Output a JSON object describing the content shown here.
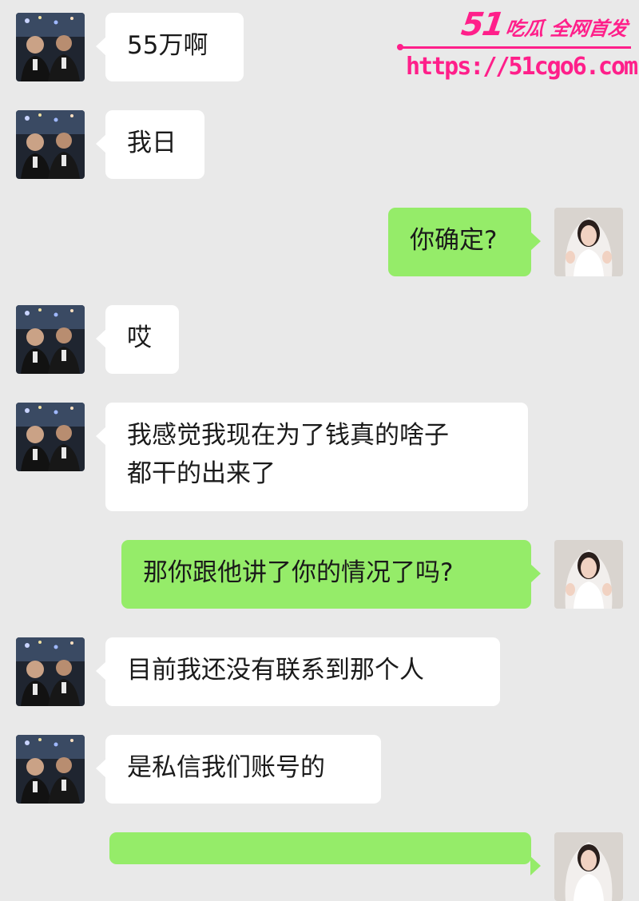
{
  "watermark": {
    "brand_number": "51",
    "brand_text": "吃瓜 全网首发",
    "url": "https://51cgo6.com",
    "color": "#ff1f8a"
  },
  "theme": {
    "background": "#e9e9e9",
    "incoming_bubble": "#ffffff",
    "outgoing_bubble": "#95ec69"
  },
  "messages": [
    {
      "sender": "contact",
      "lines": [
        "55万啊"
      ]
    },
    {
      "sender": "contact",
      "lines": [
        "我日"
      ]
    },
    {
      "sender": "me",
      "lines": [
        "你确定?"
      ]
    },
    {
      "sender": "contact",
      "lines": [
        "哎"
      ]
    },
    {
      "sender": "contact",
      "lines": [
        "我感觉我现在为了钱真的啥子",
        "都干的出来了"
      ]
    },
    {
      "sender": "me",
      "lines": [
        "那你跟他讲了你的情况了吗?"
      ]
    },
    {
      "sender": "contact",
      "lines": [
        "目前我还没有联系到那个人"
      ]
    },
    {
      "sender": "contact",
      "lines": [
        "是私信我们账号的"
      ]
    },
    {
      "sender": "me",
      "lines": [
        ""
      ]
    }
  ]
}
